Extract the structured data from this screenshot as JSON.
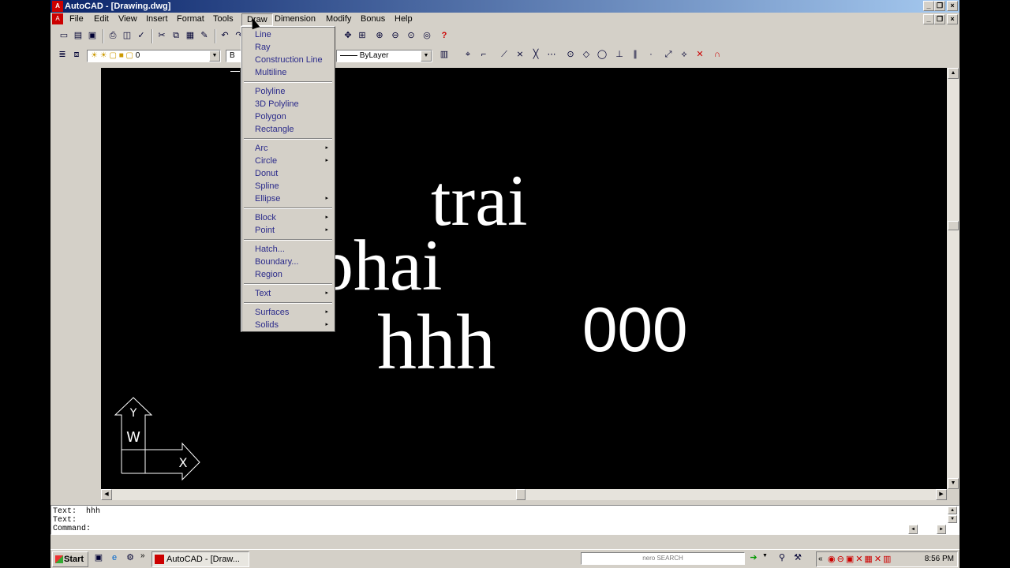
{
  "window": {
    "title": "AutoCAD - [Drawing.dwg]",
    "logo": "autocad-logo-icon"
  },
  "menu": {
    "items": [
      "File",
      "Edit",
      "View",
      "Insert",
      "Format",
      "Tools",
      "Draw",
      "Dimension",
      "Modify",
      "Bonus",
      "Help"
    ],
    "open": "Draw"
  },
  "layer_combo": {
    "value": "0"
  },
  "linetype_combo": {
    "value": "ByLayer",
    "prefix": "B"
  },
  "draw_menu": {
    "items": [
      {
        "label": "Line",
        "submenu": false
      },
      {
        "label": "Ray",
        "submenu": false
      },
      {
        "label": "Construction Line",
        "submenu": false
      },
      {
        "label": "Multiline",
        "submenu": false
      },
      {
        "label": "Polyline",
        "submenu": false
      },
      {
        "label": "3D Polyline",
        "submenu": false
      },
      {
        "label": "Polygon",
        "submenu": false
      },
      {
        "label": "Rectangle",
        "submenu": false
      },
      {
        "label": "Arc",
        "submenu": true
      },
      {
        "label": "Circle",
        "submenu": true
      },
      {
        "label": "Donut",
        "submenu": false
      },
      {
        "label": "Spline",
        "submenu": false
      },
      {
        "label": "Ellipse",
        "submenu": true
      },
      {
        "label": "Block",
        "submenu": true
      },
      {
        "label": "Point",
        "submenu": true
      },
      {
        "label": "Hatch...",
        "submenu": false
      },
      {
        "label": "Boundary...",
        "submenu": false
      },
      {
        "label": "Region",
        "submenu": false
      },
      {
        "label": "Text",
        "submenu": true
      },
      {
        "label": "Surfaces",
        "submenu": true
      },
      {
        "label": "Solids",
        "submenu": true
      }
    ]
  },
  "canvas": {
    "texts": [
      "trai",
      "phai",
      "hhh",
      "000"
    ],
    "ucs_labels": {
      "y": "Y",
      "w": "W",
      "x": "X"
    }
  },
  "command": {
    "lines": [
      "Text:  hhh",
      "Text:",
      "Command:"
    ]
  },
  "taskbar": {
    "start": "Start",
    "task": "AutoCAD - [Draw...",
    "nero": "nero SEARCH",
    "clock": "8:56 PM"
  }
}
